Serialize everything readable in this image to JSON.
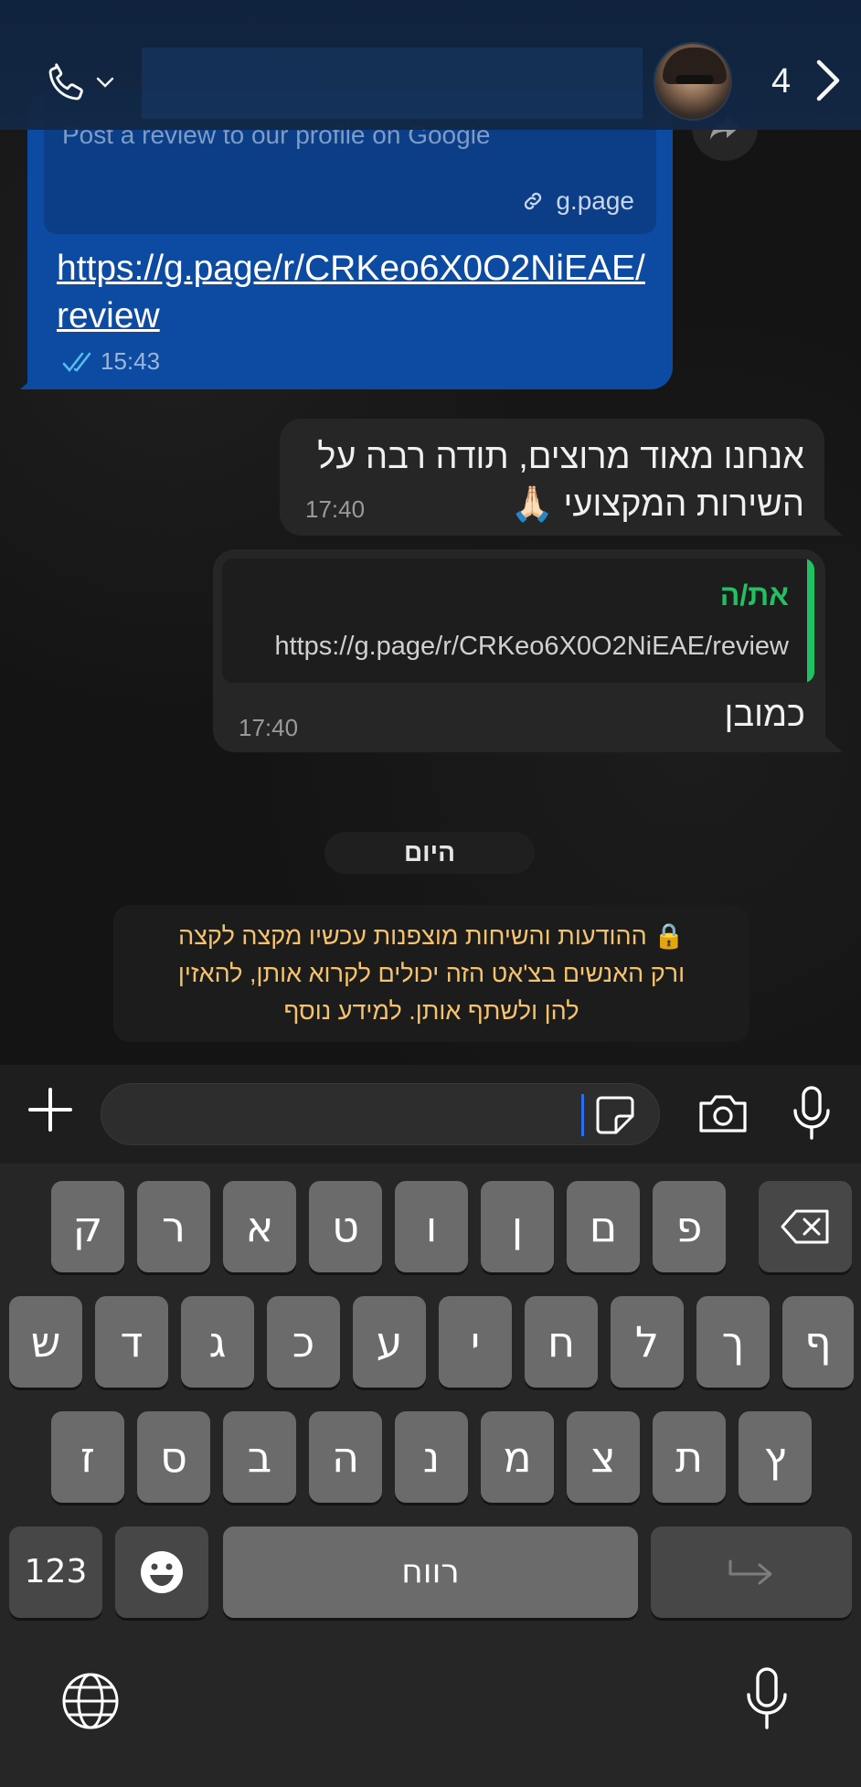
{
  "header": {
    "unread_count": "4"
  },
  "messages": {
    "outgoing_link": {
      "preview_description": "Post a review to our profile on Google",
      "preview_domain": "g.page",
      "url_line1": "https://g.page/r/CRKeo6X0O2NiEAE/",
      "url_line2": "review",
      "time": "15:43"
    },
    "incoming_thanks": {
      "line1": "אנחנו מאוד מרוצים, תודה רבה על",
      "line2": "השירות המקצועי 🙏🏻",
      "time": "17:40"
    },
    "incoming_reply": {
      "quote_author": "את/ה",
      "quote_text": "https://g.page/r/CRKeo6X0O2NiEAE/review",
      "text": "כמובן",
      "time": "17:40"
    }
  },
  "day_separator": "היום",
  "encryption_notice": {
    "line1": "🔒 ההודעות והשיחות מוצפנות עכשיו מקצה לקצה",
    "line2": "ורק האנשים בצ'אט הזה יכולים לקרוא אותן, להאזין",
    "line3": "להן ולשתף אותן. למידע נוסף"
  },
  "composer": {
    "value": ""
  },
  "keyboard": {
    "row1": [
      "ק",
      "ר",
      "א",
      "ט",
      "ו",
      "ן",
      "ם",
      "פ"
    ],
    "row2": [
      "ש",
      "ד",
      "ג",
      "כ",
      "ע",
      "י",
      "ח",
      "ל",
      "ך",
      "ף"
    ],
    "row3": [
      "ז",
      "ס",
      "ב",
      "ה",
      "נ",
      "מ",
      "צ",
      "ת",
      "ץ"
    ],
    "numbers_label": "123",
    "space_label": "רווח"
  },
  "colors": {
    "header_bg": "#132845",
    "outgoing_bubble": "#0d4aa1",
    "incoming_bubble": "#262626",
    "quote_accent": "#21c063",
    "encryption_text": "#f6c26b"
  }
}
